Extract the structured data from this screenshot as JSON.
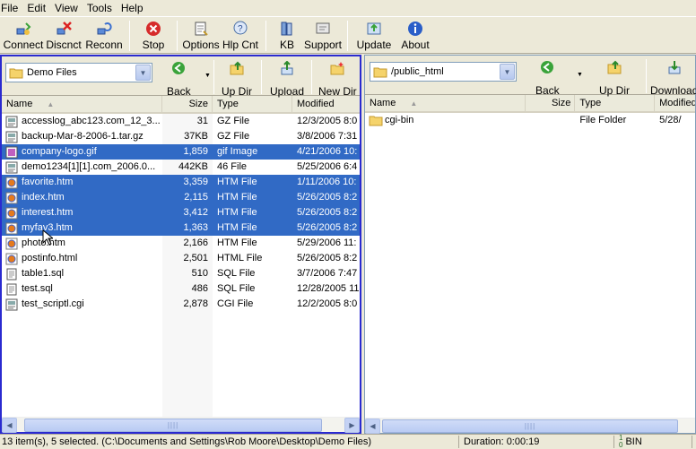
{
  "menu": [
    "File",
    "Edit",
    "View",
    "Tools",
    "Help"
  ],
  "toolbar": [
    {
      "label": "Connect",
      "icon": "connect-icon"
    },
    {
      "label": "Discnct",
      "icon": "disconnect-icon"
    },
    {
      "label": "Reconn",
      "icon": "reconnect-icon"
    },
    {
      "label": "Stop",
      "icon": "stop-icon"
    },
    {
      "label": "Options",
      "icon": "options-icon"
    },
    {
      "label": "Hlp Cnt",
      "icon": "help-contents-icon"
    },
    {
      "label": "KB",
      "icon": "knowledge-base-icon"
    },
    {
      "label": "Support",
      "icon": "support-icon"
    },
    {
      "label": "Update",
      "icon": "update-icon"
    },
    {
      "label": "About",
      "icon": "about-icon"
    }
  ],
  "left": {
    "folder": "Demo Files",
    "buttons": [
      "Back",
      "Up Dir",
      "Upload",
      "New Dir"
    ],
    "columns": [
      "Name",
      "Size",
      "Type",
      "Modified"
    ],
    "files": [
      {
        "name": "accesslog_abc123.com_12_3...",
        "size": "31",
        "type": "GZ File",
        "modified": "12/3/2005 8:0",
        "icon": "archive-file-icon",
        "selected": false
      },
      {
        "name": "backup-Mar-8-2006-1.tar.gz",
        "size": "37KB",
        "type": "GZ File",
        "modified": "3/8/2006 7:31",
        "icon": "archive-file-icon",
        "selected": false
      },
      {
        "name": "company-logo.gif",
        "size": "1,859",
        "type": "gif Image",
        "modified": "4/21/2006 10:",
        "icon": "image-file-icon",
        "selected": true
      },
      {
        "name": "demo1234[1][1].com_2006.0...",
        "size": "442KB",
        "type": "46 File",
        "modified": "5/25/2006 6:4",
        "icon": "archive-file-icon",
        "selected": false
      },
      {
        "name": "favorite.htm",
        "size": "3,359",
        "type": "HTM File",
        "modified": "1/11/2006 10:",
        "icon": "html-file-icon",
        "selected": true
      },
      {
        "name": "index.htm",
        "size": "2,115",
        "type": "HTM File",
        "modified": "5/26/2005 8:2",
        "icon": "html-file-icon",
        "selected": true
      },
      {
        "name": "interest.htm",
        "size": "3,412",
        "type": "HTM File",
        "modified": "5/26/2005 8:2",
        "icon": "html-file-icon",
        "selected": true
      },
      {
        "name": "myfav3.htm",
        "size": "1,363",
        "type": "HTM File",
        "modified": "5/26/2005 8:2",
        "icon": "html-file-icon",
        "selected": true
      },
      {
        "name": "photo.htm",
        "size": "2,166",
        "type": "HTM File",
        "modified": "5/29/2006 11:",
        "icon": "html-file-icon",
        "selected": false
      },
      {
        "name": "postinfo.html",
        "size": "2,501",
        "type": "HTML File",
        "modified": "5/26/2005 8:2",
        "icon": "html-file-icon",
        "selected": false
      },
      {
        "name": "table1.sql",
        "size": "510",
        "type": "SQL File",
        "modified": "3/7/2006 7:47",
        "icon": "text-file-icon",
        "selected": false
      },
      {
        "name": "test.sql",
        "size": "486",
        "type": "SQL File",
        "modified": "12/28/2005 11",
        "icon": "text-file-icon",
        "selected": false
      },
      {
        "name": "test_scriptl.cgi",
        "size": "2,878",
        "type": "CGI File",
        "modified": "12/2/2005 8:0",
        "icon": "archive-file-icon",
        "selected": false
      }
    ]
  },
  "right": {
    "folder": "/public_html",
    "buttons": [
      "Back",
      "Up Dir",
      "Download"
    ],
    "columns": [
      "Name",
      "Size",
      "Type",
      "Modified"
    ],
    "files": [
      {
        "name": "cgi-bin",
        "size": "",
        "type": "File Folder",
        "modified": "5/28/",
        "icon": "folder-icon",
        "selected": false
      }
    ]
  },
  "status": {
    "summary": "13 item(s), 5 selected.  (C:\\Documents and Settings\\Rob Moore\\Desktop\\Demo Files)",
    "duration": "Duration: 0:00:19",
    "mode": "BIN"
  },
  "colors": {
    "selection": "#316ac5",
    "active_pane_border": "#2a2ad0"
  }
}
